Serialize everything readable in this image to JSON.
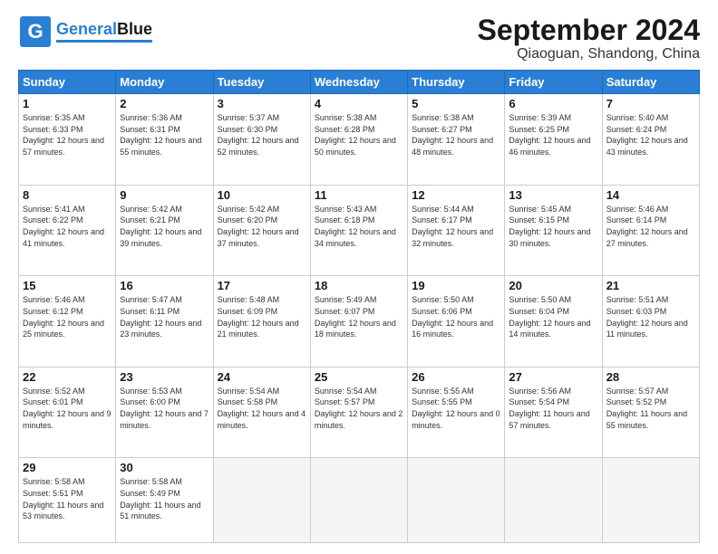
{
  "logo": {
    "general": "General",
    "blue": "Blue"
  },
  "header": {
    "month": "September 2024",
    "location": "Qiaoguan, Shandong, China"
  },
  "days_of_week": [
    "Sunday",
    "Monday",
    "Tuesday",
    "Wednesday",
    "Thursday",
    "Friday",
    "Saturday"
  ],
  "weeks": [
    [
      {
        "day": "1",
        "sunrise": "5:35 AM",
        "sunset": "6:33 PM",
        "daylight": "12 hours and 57 minutes."
      },
      {
        "day": "2",
        "sunrise": "5:36 AM",
        "sunset": "6:31 PM",
        "daylight": "12 hours and 55 minutes."
      },
      {
        "day": "3",
        "sunrise": "5:37 AM",
        "sunset": "6:30 PM",
        "daylight": "12 hours and 52 minutes."
      },
      {
        "day": "4",
        "sunrise": "5:38 AM",
        "sunset": "6:28 PM",
        "daylight": "12 hours and 50 minutes."
      },
      {
        "day": "5",
        "sunrise": "5:38 AM",
        "sunset": "6:27 PM",
        "daylight": "12 hours and 48 minutes."
      },
      {
        "day": "6",
        "sunrise": "5:39 AM",
        "sunset": "6:25 PM",
        "daylight": "12 hours and 46 minutes."
      },
      {
        "day": "7",
        "sunrise": "5:40 AM",
        "sunset": "6:24 PM",
        "daylight": "12 hours and 43 minutes."
      }
    ],
    [
      {
        "day": "8",
        "sunrise": "5:41 AM",
        "sunset": "6:22 PM",
        "daylight": "12 hours and 41 minutes."
      },
      {
        "day": "9",
        "sunrise": "5:42 AM",
        "sunset": "6:21 PM",
        "daylight": "12 hours and 39 minutes."
      },
      {
        "day": "10",
        "sunrise": "5:42 AM",
        "sunset": "6:20 PM",
        "daylight": "12 hours and 37 minutes."
      },
      {
        "day": "11",
        "sunrise": "5:43 AM",
        "sunset": "6:18 PM",
        "daylight": "12 hours and 34 minutes."
      },
      {
        "day": "12",
        "sunrise": "5:44 AM",
        "sunset": "6:17 PM",
        "daylight": "12 hours and 32 minutes."
      },
      {
        "day": "13",
        "sunrise": "5:45 AM",
        "sunset": "6:15 PM",
        "daylight": "12 hours and 30 minutes."
      },
      {
        "day": "14",
        "sunrise": "5:46 AM",
        "sunset": "6:14 PM",
        "daylight": "12 hours and 27 minutes."
      }
    ],
    [
      {
        "day": "15",
        "sunrise": "5:46 AM",
        "sunset": "6:12 PM",
        "daylight": "12 hours and 25 minutes."
      },
      {
        "day": "16",
        "sunrise": "5:47 AM",
        "sunset": "6:11 PM",
        "daylight": "12 hours and 23 minutes."
      },
      {
        "day": "17",
        "sunrise": "5:48 AM",
        "sunset": "6:09 PM",
        "daylight": "12 hours and 21 minutes."
      },
      {
        "day": "18",
        "sunrise": "5:49 AM",
        "sunset": "6:07 PM",
        "daylight": "12 hours and 18 minutes."
      },
      {
        "day": "19",
        "sunrise": "5:50 AM",
        "sunset": "6:06 PM",
        "daylight": "12 hours and 16 minutes."
      },
      {
        "day": "20",
        "sunrise": "5:50 AM",
        "sunset": "6:04 PM",
        "daylight": "12 hours and 14 minutes."
      },
      {
        "day": "21",
        "sunrise": "5:51 AM",
        "sunset": "6:03 PM",
        "daylight": "12 hours and 11 minutes."
      }
    ],
    [
      {
        "day": "22",
        "sunrise": "5:52 AM",
        "sunset": "6:01 PM",
        "daylight": "12 hours and 9 minutes."
      },
      {
        "day": "23",
        "sunrise": "5:53 AM",
        "sunset": "6:00 PM",
        "daylight": "12 hours and 7 minutes."
      },
      {
        "day": "24",
        "sunrise": "5:54 AM",
        "sunset": "5:58 PM",
        "daylight": "12 hours and 4 minutes."
      },
      {
        "day": "25",
        "sunrise": "5:54 AM",
        "sunset": "5:57 PM",
        "daylight": "12 hours and 2 minutes."
      },
      {
        "day": "26",
        "sunrise": "5:55 AM",
        "sunset": "5:55 PM",
        "daylight": "12 hours and 0 minutes."
      },
      {
        "day": "27",
        "sunrise": "5:56 AM",
        "sunset": "5:54 PM",
        "daylight": "11 hours and 57 minutes."
      },
      {
        "day": "28",
        "sunrise": "5:57 AM",
        "sunset": "5:52 PM",
        "daylight": "11 hours and 55 minutes."
      }
    ],
    [
      {
        "day": "29",
        "sunrise": "5:58 AM",
        "sunset": "5:51 PM",
        "daylight": "11 hours and 53 minutes."
      },
      {
        "day": "30",
        "sunrise": "5:58 AM",
        "sunset": "5:49 PM",
        "daylight": "11 hours and 51 minutes."
      },
      null,
      null,
      null,
      null,
      null
    ]
  ]
}
